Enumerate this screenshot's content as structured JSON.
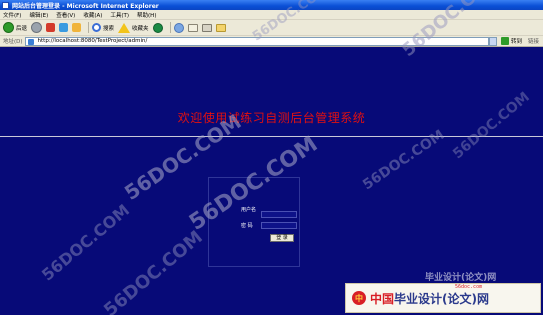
{
  "window": {
    "title": "网站后台管理登录 - Microsoft Internet Explorer"
  },
  "menubar": {
    "items": [
      "文件(F)",
      "编辑(E)",
      "查看(V)",
      "收藏(A)",
      "工具(T)",
      "帮助(H)"
    ]
  },
  "toolbar": {
    "back_label": "后退",
    "search_label": "搜索",
    "favorites_label": "收藏夹"
  },
  "addressbar": {
    "label": "地址(D)",
    "url": "http://localhost:8080/TestProject/admin/",
    "go_label": "转到",
    "links_label": "链接"
  },
  "page": {
    "welcome": "欢迎使用试练习自测后台管理系统",
    "username_label": "用户名",
    "password_label": "密 码",
    "login_button": "登 录"
  },
  "watermarks": {
    "text": "56DOC.COM"
  },
  "banner": {
    "logo_glyph": "中",
    "brand_cn": "中国",
    "brand_rest": "毕业设计(论文)网",
    "domain": "56doc.com",
    "top_text": "毕业设计(论文)网"
  },
  "colors": {
    "content_bg": "#070a78",
    "welcome_text": "#e11010"
  }
}
